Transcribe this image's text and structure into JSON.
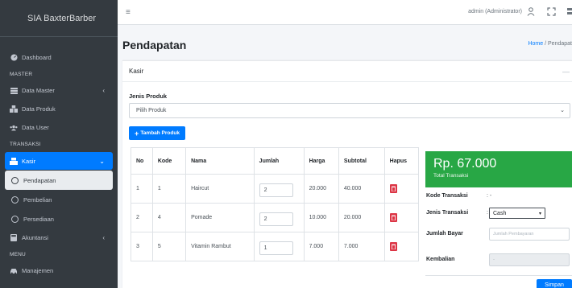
{
  "app": {
    "brand": "SIA BaxterBarber"
  },
  "sidebar": {
    "items": [
      {
        "label": "Dashboard"
      },
      {
        "header": "MASTER"
      },
      {
        "label": "Data Master"
      },
      {
        "label": "Data Produk"
      },
      {
        "label": "Data User"
      },
      {
        "header": "TRANSAKSI"
      },
      {
        "label": "Kasir"
      },
      {
        "label": "Pendapatan"
      },
      {
        "label": "Pembelian"
      },
      {
        "label": "Persediaan"
      },
      {
        "label": "Akuntansi"
      },
      {
        "header": "MENU"
      },
      {
        "label": "Manajemen"
      }
    ]
  },
  "topbar": {
    "user": "admin (Administrator)"
  },
  "page": {
    "title": "Pendapatan",
    "breadcrumb_home": "Home",
    "breadcrumb_current": "Pendapat"
  },
  "card": {
    "header": "Kasir",
    "jenis_produk_label": "Jenis Produk",
    "select_placeholder": "Pilih Produk",
    "add_button": "Tambah Produk"
  },
  "table": {
    "headers": [
      "No",
      "Kode",
      "Nama",
      "Jumlah",
      "Harga",
      "Subtotal",
      "Hapus"
    ],
    "rows": [
      [
        "1",
        "1",
        "Haircut",
        "2",
        "20.000",
        "40.000"
      ],
      [
        "2",
        "4",
        "Pomade",
        "2",
        "10.000",
        "20.000"
      ],
      [
        "3",
        "5",
        "Vitamin Rambut",
        "1",
        "7.000",
        "7.000"
      ]
    ]
  },
  "summary": {
    "total_amount": "Rp. 67.000",
    "total_label": "Total Transaksi",
    "kode_label": "Kode Transaksi",
    "kode_value": ": -",
    "jenis_label": "Jenis Transaksi",
    "jenis_prefix": ":",
    "jenis_value": "Cash",
    "bayar_label": "Jumlah Bayar",
    "bayar_placeholder": "Jumlah Pembayaran",
    "kembali_label": "Kembalian",
    "kembali_value": "-",
    "save_button": "Simpan"
  },
  "colors": {
    "sidebar": "#343a40",
    "primary": "#007bff",
    "success": "#28a745",
    "danger": "#dc3545"
  }
}
